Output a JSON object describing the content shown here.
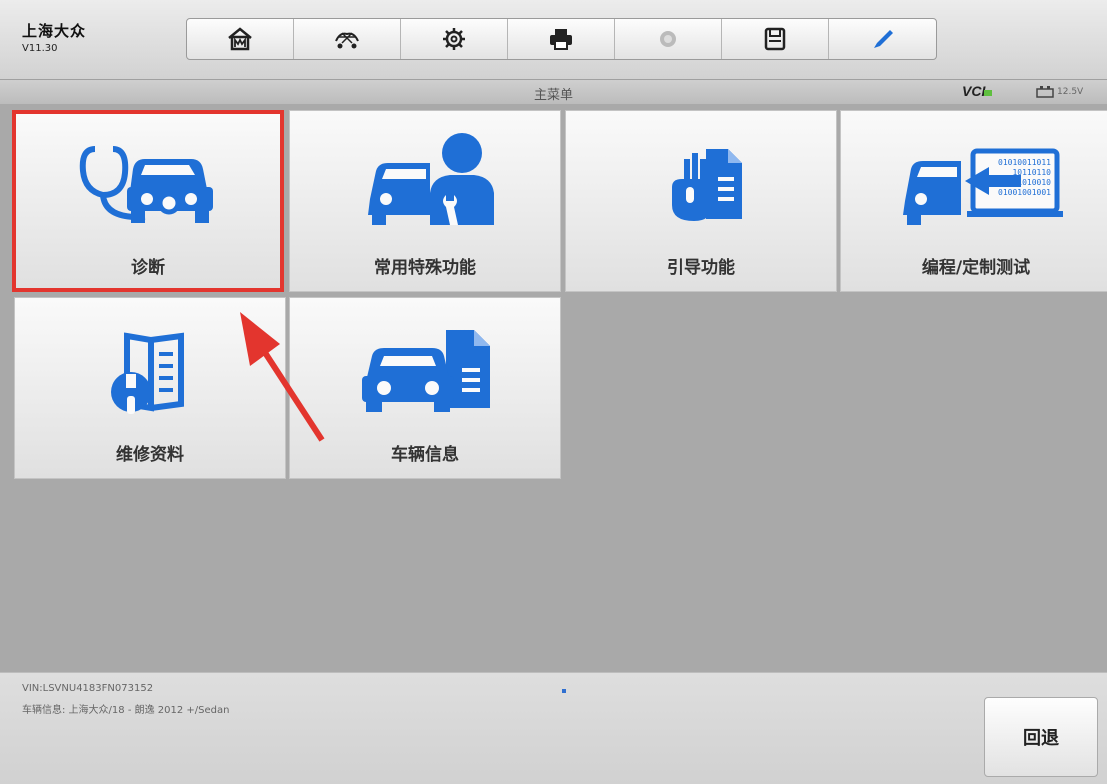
{
  "app": {
    "name": "上海大众",
    "version": "V11.30"
  },
  "toolbar": {
    "buttons": [
      {
        "icon": "home-icon"
      },
      {
        "icon": "vehicle-menu-icon"
      },
      {
        "icon": "settings-gear-icon"
      },
      {
        "icon": "print-icon"
      },
      {
        "icon": "help-icon",
        "disabled": true
      },
      {
        "icon": "save-icon"
      },
      {
        "icon": "pen-icon"
      }
    ]
  },
  "title_bar": {
    "title": "主菜单",
    "vci_label": "VCI",
    "voltage": "12.5V"
  },
  "menu": {
    "tiles": [
      {
        "label": "诊断",
        "icon": "stethoscope-car-icon",
        "selected": true
      },
      {
        "label": "常用特殊功能",
        "icon": "car-technician-icon"
      },
      {
        "label": "引导功能",
        "icon": "hand-document-icon"
      },
      {
        "label": "编程/定制测试",
        "icon": "car-binary-code-icon"
      },
      {
        "label": "维修资料",
        "icon": "wrench-book-icon"
      },
      {
        "label": "车辆信息",
        "icon": "car-document-icon"
      }
    ]
  },
  "footer": {
    "vin": "VIN:LSVNU4183FN073152",
    "vehicle_info": "车辆信息: 上海大众/18 - 朗逸 2012 +/Sedan",
    "back_label": "回退"
  },
  "colors": {
    "accent_blue": "#1f6fd6",
    "highlight_red": "#e3352e",
    "vci_green": "#5fbf3f"
  }
}
